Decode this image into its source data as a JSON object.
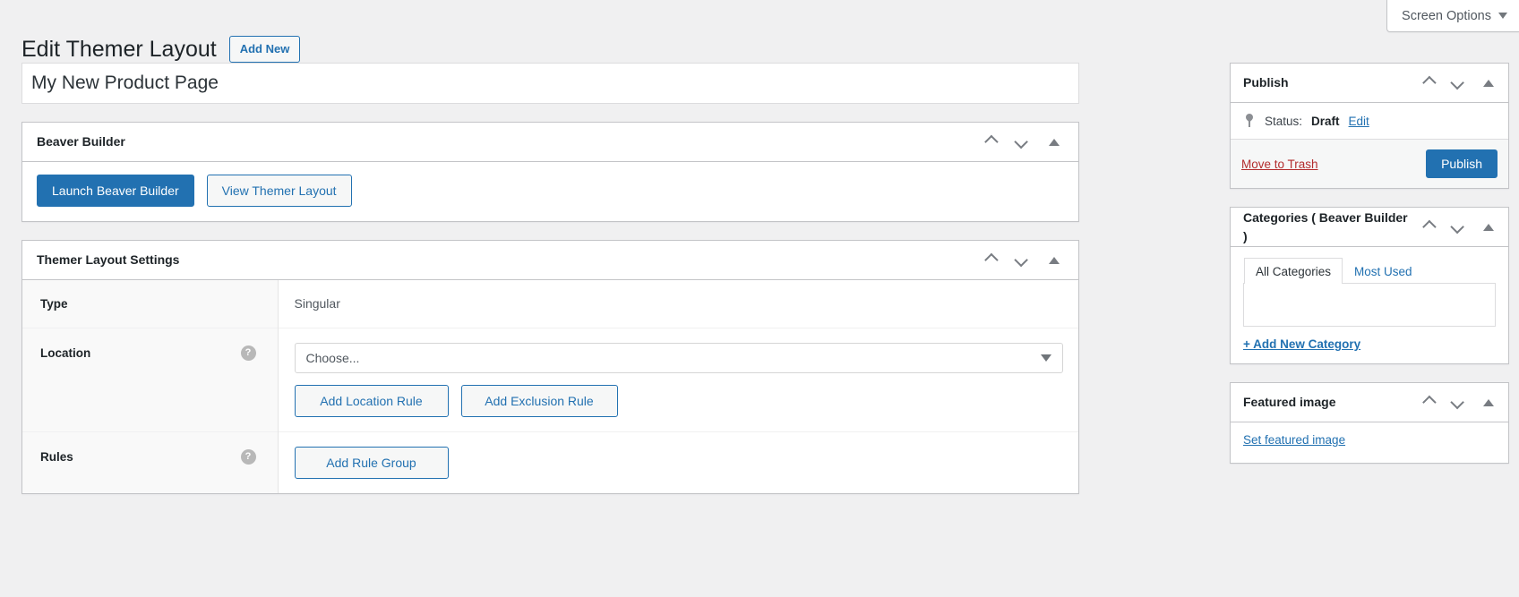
{
  "screen_options": {
    "label": "Screen Options",
    "caret_icon": "caret-down-icon"
  },
  "header": {
    "title": "Edit Themer Layout",
    "add_new_label": "Add New"
  },
  "title_field": {
    "value": "My New Product Page",
    "placeholder": "Add title"
  },
  "panels": {
    "beaver_builder": {
      "title": "Beaver Builder",
      "launch_label": "Launch Beaver Builder",
      "view_label": "View Themer Layout"
    },
    "themer_settings": {
      "title": "Themer Layout Settings",
      "rows": {
        "type": {
          "label": "Type",
          "value": "Singular"
        },
        "location": {
          "label": "Location",
          "help_icon": "help-circle-icon",
          "select_value": "Choose...",
          "add_location_label": "Add Location Rule",
          "add_exclusion_label": "Add Exclusion Rule"
        },
        "rules": {
          "label": "Rules",
          "help_icon": "help-circle-icon",
          "add_rule_group_label": "Add Rule Group"
        }
      }
    }
  },
  "sidebar": {
    "publish": {
      "title": "Publish",
      "status_prefix": "Status:",
      "status_value": "Draft",
      "status_edit_label": "Edit",
      "move_to_trash_label": "Move to Trash",
      "publish_button_label": "Publish"
    },
    "categories": {
      "title": "Categories ( Beaver Builder )",
      "tabs": [
        {
          "label": "All Categories",
          "active": true
        },
        {
          "label": "Most Used",
          "active": false
        }
      ],
      "add_new_category_label": "+ Add New Category"
    },
    "featured_image": {
      "title": "Featured image",
      "set_link_label": "Set featured image"
    }
  },
  "colors": {
    "accent_blue": "#2271b1",
    "danger_red": "#b32d2e",
    "page_bg": "#f0f0f1",
    "panel_border": "#c3c4c7"
  },
  "icons": {
    "collapse_up": "chevron-up-icon",
    "collapse_down": "chevron-down-icon",
    "toggle_panel": "triangle-up-icon",
    "status_pin": "pin-icon"
  }
}
